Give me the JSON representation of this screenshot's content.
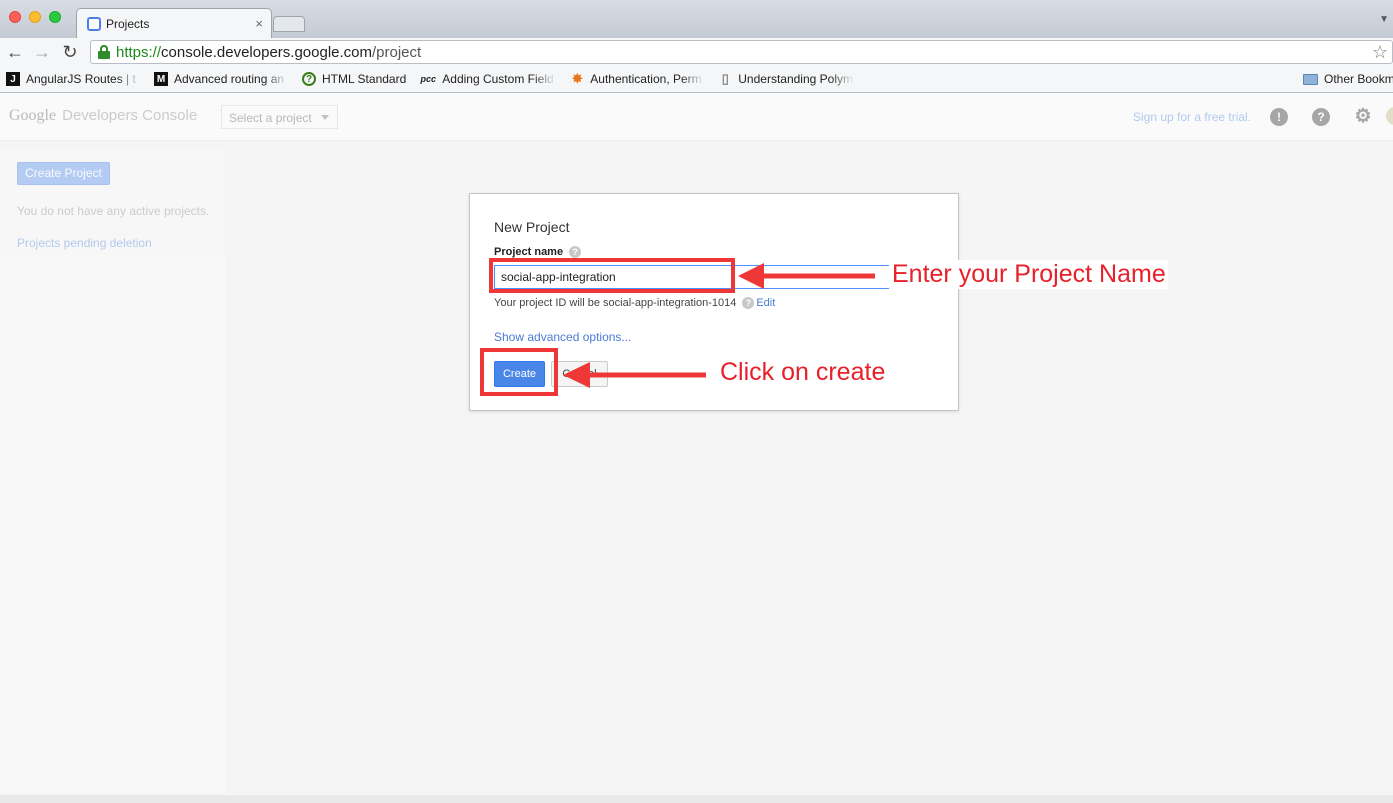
{
  "browser": {
    "tab": {
      "title": "Projects",
      "close": "×"
    },
    "url": {
      "scheme": "https://",
      "host": "console.developers.google.com",
      "path": "/project"
    },
    "bookmarks": [
      {
        "icon": "J",
        "label": "AngularJS Routes | t"
      },
      {
        "icon": "M",
        "label": "Advanced routing an"
      },
      {
        "icon": "?",
        "label": "HTML Standard"
      },
      {
        "icon": "pcc",
        "label": "Adding Custom Field"
      },
      {
        "icon": "✸",
        "label": "Authentication, Perm"
      },
      {
        "icon": "▯",
        "label": "Understanding Polym"
      }
    ],
    "other_bookmarks": "Other Bookm"
  },
  "header": {
    "logo": "Google",
    "logo_sub": "Developers Console",
    "project_select": "Select a project",
    "signup": "Sign up for a free trial."
  },
  "sidebar": {
    "create_button": "Create Project",
    "message": "You do not have any active projects.",
    "pending_link": "Projects pending deletion"
  },
  "dialog": {
    "title": "New Project",
    "field_label": "Project name",
    "project_name_value": "social-app-integration",
    "project_id_text": "Your project ID will be social-app-integration-1014",
    "edit_link": "Edit",
    "advanced_link": "Show advanced options...",
    "create_button": "Create",
    "cancel_button": "Cancel"
  },
  "annotations": {
    "name_callout": "Enter your Project Name",
    "create_callout": "Click on create",
    "color": "#ee3838"
  }
}
